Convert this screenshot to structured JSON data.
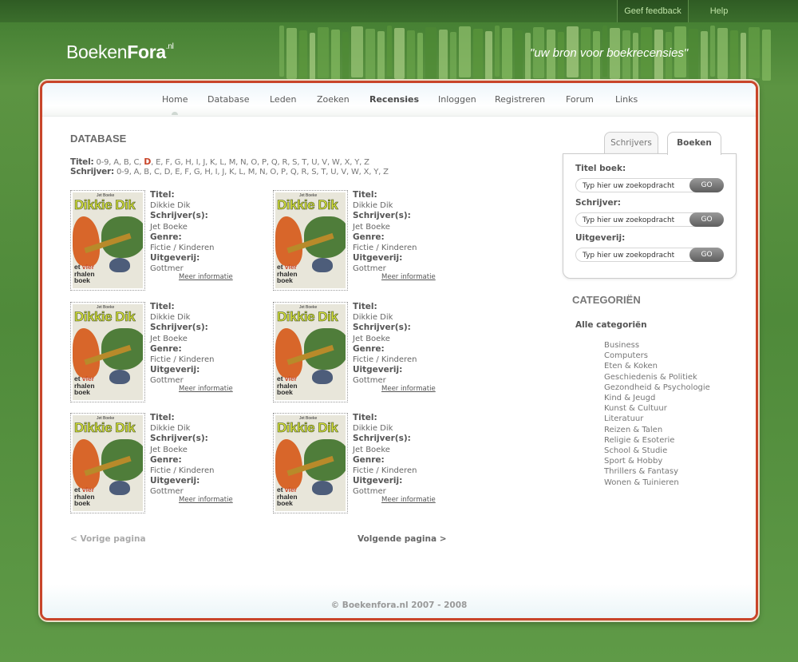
{
  "topbar": {
    "feedback": "Geef feedback",
    "help": "Help"
  },
  "header": {
    "logo_main": "Boeken",
    "logo_bold": "Fora",
    "logo_suffix": ".nl",
    "tagline": "\"uw bron voor boekrecensies\""
  },
  "nav": [
    {
      "label": "Home",
      "bold": false
    },
    {
      "label": "Database",
      "bold": false
    },
    {
      "label": "Leden",
      "bold": false
    },
    {
      "label": "Zoeken",
      "bold": false
    },
    {
      "label": "Recensies",
      "bold": true
    },
    {
      "label": "Inloggen",
      "bold": false
    },
    {
      "label": "Registreren",
      "bold": false
    },
    {
      "label": "Forum",
      "bold": false
    },
    {
      "label": "Links",
      "bold": false
    }
  ],
  "main": {
    "title": "DATABASE",
    "titel_label": "Titel:",
    "schrijver_label": "Schrijver:",
    "letters": [
      "0-9",
      "A",
      "B",
      "C",
      "D",
      "E",
      "F",
      "G",
      "H",
      "I",
      "J",
      "K",
      "L",
      "M",
      "N",
      "O",
      "P",
      "Q",
      "R",
      "S",
      "T",
      "U",
      "V",
      "W",
      "X",
      "Y",
      "Z"
    ],
    "active_letter": "D"
  },
  "book_labels": {
    "title": "Titel:",
    "author": "Schrijver(s):",
    "genre": "Genre:",
    "publisher": "Uitgeverij:",
    "more": "Meer informatie"
  },
  "cover": {
    "author": "Jet Boeke",
    "title": "Dikkie Dik",
    "sub1": "et ",
    "sub1_red": "vier",
    "sub2": "rhalen",
    "sub3": "boek"
  },
  "books": [
    {
      "title": "Dikkie Dik",
      "author": "Jet Boeke",
      "genre": "Fictie / Kinderen",
      "publisher": "Gottmer"
    },
    {
      "title": "Dikkie Dik",
      "author": "Jet Boeke",
      "genre": "Fictie / Kinderen",
      "publisher": "Gottmer"
    },
    {
      "title": "Dikkie Dik",
      "author": "Jet Boeke",
      "genre": "Fictie / Kinderen",
      "publisher": "Gottmer"
    },
    {
      "title": "Dikkie Dik",
      "author": "Jet Boeke",
      "genre": "Fictie / Kinderen",
      "publisher": "Gottmer"
    },
    {
      "title": "Dikkie Dik",
      "author": "Jet Boeke",
      "genre": "Fictie / Kinderen",
      "publisher": "Gottmer"
    },
    {
      "title": "Dikkie Dik",
      "author": "Jet Boeke",
      "genre": "Fictie / Kinderen",
      "publisher": "Gottmer"
    }
  ],
  "pager": {
    "prev": "< Vorige pagina",
    "next": "Volgende pagina >"
  },
  "search": {
    "tabs": [
      {
        "label": "Schrijvers",
        "active": false
      },
      {
        "label": "Boeken",
        "active": true
      }
    ],
    "fields": [
      {
        "label": "Titel boek:",
        "value": "Typ hier uw zoekopdracht",
        "button": "GO"
      },
      {
        "label": "Schrijver:",
        "value": "Typ hier uw zoekopdracht",
        "button": "GO"
      },
      {
        "label": "Uitgeverij:",
        "value": "Typ hier uw zoekopdracht",
        "button": "GO"
      }
    ]
  },
  "categories": {
    "title": "CATEGORIËN",
    "all": "Alle categoriën",
    "items": [
      "Business",
      "Computers",
      "Eten & Koken",
      "Geschiedenis & Politiek",
      "Gezondheid & Psychologie",
      "Kind & Jeugd",
      "Kunst & Cultuur",
      "Literatuur",
      "Reizen & Talen",
      "Religie & Esoterie",
      "School & Studie",
      "Sport & Hobby",
      "Thrillers & Fantasy",
      "Wonen & Tuinieren"
    ]
  },
  "footer": {
    "copyright": "© Boekenfora.nl 2007 - 2008"
  },
  "colors": {
    "accent": "#c8452a",
    "background": "#5c9442",
    "header_dark": "#2f5c24"
  }
}
